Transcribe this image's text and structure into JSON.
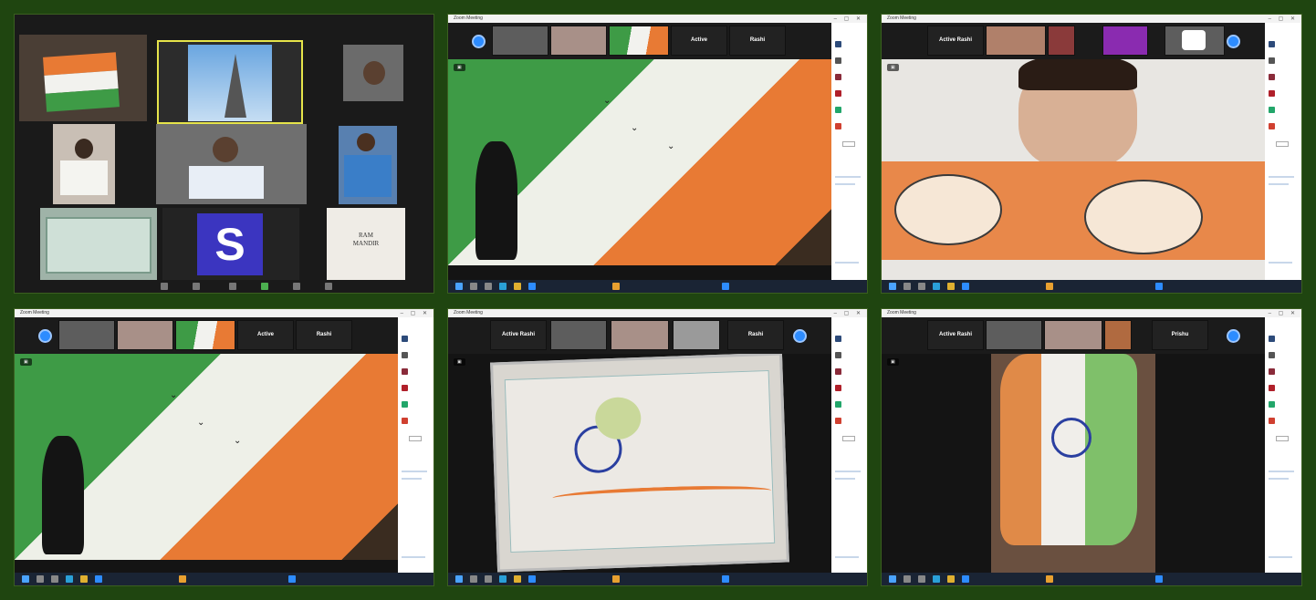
{
  "meeting": {
    "window_title": "Zoom Meeting"
  },
  "screen1": {
    "tile_s_letter": "S",
    "tile_text_card": "RAM\nMANDIR"
  },
  "strips": {
    "s2": {
      "active_label": "Active",
      "name_label": "Rashi"
    },
    "s3": {
      "active_label": "Active Rashi"
    },
    "s4": {
      "active_label": "Active",
      "name_label": "Rashi"
    },
    "s5": {
      "active_label": "Active Rashi",
      "name_label": "Rashi"
    },
    "s6": {
      "active_label": "Active Rashi",
      "name_label": "Prishu"
    }
  },
  "colors": {
    "saffron": "#e87a34",
    "white": "#f2f2ee",
    "green": "#3e9b46",
    "chakra": "#2a3fa0",
    "zoom_blue": "#2d8cff"
  },
  "icons": {
    "nav": "chevron-circle-icon",
    "taskbar": [
      "windows-start-icon",
      "search-icon",
      "task-view-icon",
      "edge-icon",
      "folder-icon",
      "store-icon",
      "mail-icon",
      "zoom-icon"
    ]
  }
}
